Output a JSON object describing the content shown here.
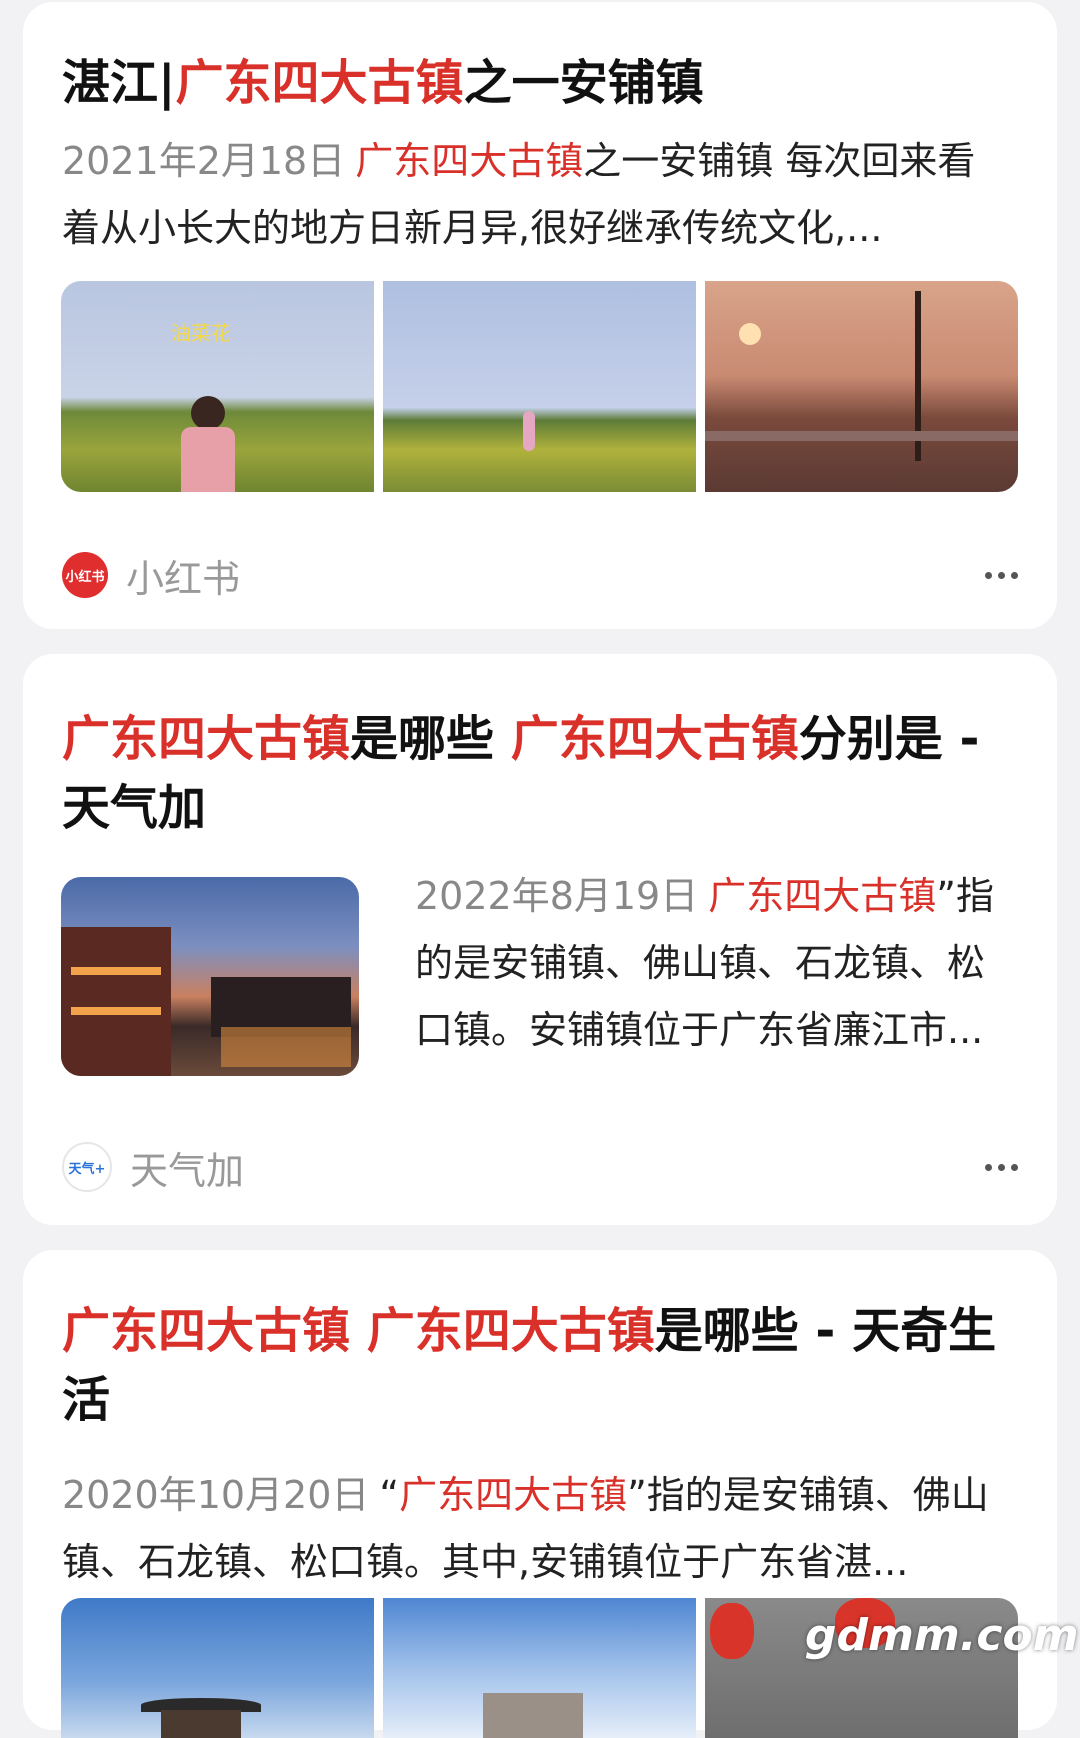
{
  "results": [
    {
      "title_parts": [
        "湛江|",
        "广东四大古镇",
        "之一安铺镇"
      ],
      "date": "2021年2月18日",
      "snippet_parts": [
        "广东四大古镇",
        "之一安铺镇 每次回来看着从小长大的地方日新月异,很好继承传统文化,..."
      ],
      "image_overlay_text": "油菜花",
      "source": {
        "name": "小红书",
        "logo_text": "小红书"
      }
    },
    {
      "title_parts": [
        "广东四大古镇",
        "是哪些 ",
        "广东四大古镇",
        "分别是 - 天气加"
      ],
      "date": "2022年8月19日",
      "snippet_parts": [
        "广东四大古镇",
        "”指的是安铺镇、佛山镇、石龙镇、松口镇。安铺镇位于广东省廉江市..."
      ],
      "source": {
        "name": "天气加",
        "logo_text": "天气+"
      }
    },
    {
      "title_parts": [
        "广东四大古镇 广东四大古镇",
        "是哪些 - 天奇生活"
      ],
      "date": "2020年10月20日",
      "snippet_parts": [
        "“",
        "广东四大古镇",
        "”指的是安铺镇、佛山镇、石龙镇、松口镇。其中,安铺镇位于广东省湛..."
      ]
    }
  ],
  "watermark": "gdmm.com",
  "colors": {
    "highlight": "#d9302a",
    "background": "#f2f2f5",
    "card": "#ffffff"
  }
}
